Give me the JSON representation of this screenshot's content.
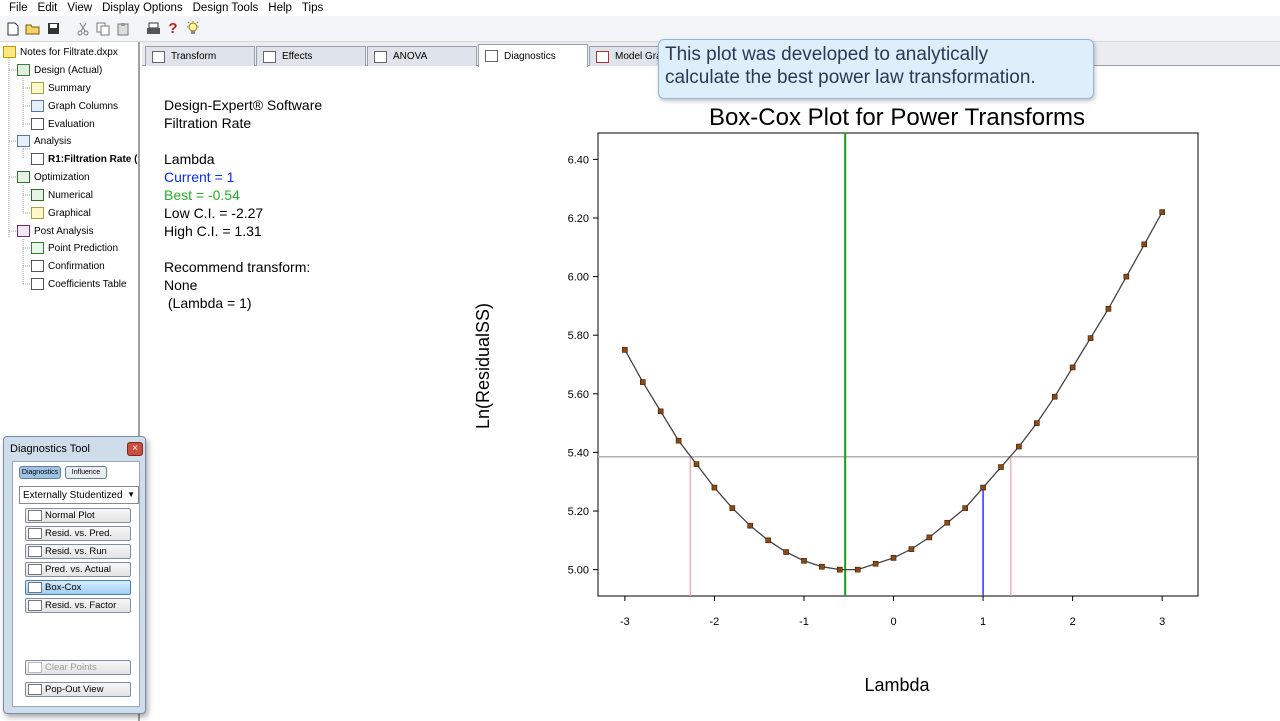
{
  "menu": [
    "File",
    "Edit",
    "View",
    "Display Options",
    "Design Tools",
    "Help",
    "Tips"
  ],
  "toolbar": {
    "icons": [
      "new-file-icon",
      "open-folder-icon",
      "save-icon",
      "cut-icon",
      "copy-icon",
      "paste-icon",
      "print-icon",
      "help-icon",
      "tip-lightbulb-icon"
    ]
  },
  "tree": {
    "root": "Notes for Filtrate.dxpx",
    "design": "Design (Actual)",
    "summary": "Summary",
    "graph_columns": "Graph Columns",
    "evaluation": "Evaluation",
    "analysis": "Analysis",
    "r1": "R1:Filtration Rate (",
    "optimization": "Optimization",
    "numerical": "Numerical",
    "graphical": "Graphical",
    "post_analysis": "Post Analysis",
    "point_prediction": "Point Prediction",
    "confirmation": "Confirmation",
    "coefficients_table": "Coefficients Table"
  },
  "tabs": {
    "transform": "Transform",
    "effects": "Effects",
    "anova": "ANOVA",
    "diagnostics": "Diagnostics",
    "model_graphs": "Model Gra"
  },
  "callout": {
    "line1": "This plot was developed to analytically",
    "line2": "calculate the best power law transformation."
  },
  "info": {
    "software": "Design-Expert® Software",
    "response": "Filtration Rate",
    "lambda_heading": "Lambda",
    "current": "Current = 1",
    "best": "Best = -0.54",
    "low_ci": "Low C.I. = -2.27",
    "high_ci": "High C.I. = 1.31",
    "recommend": "Recommend transform:",
    "recommend_value": "None",
    "recommend_lambda": " (Lambda = 1)"
  },
  "chart_data": {
    "type": "line",
    "title": "Box-Cox Plot for Power Transforms",
    "xlabel": "Lambda",
    "ylabel": "Ln(ResidualSS)",
    "xlim": [
      -3.3,
      3.4
    ],
    "ylim": [
      4.91,
      6.49
    ],
    "xticks": [
      -3,
      -2,
      -1,
      0,
      1,
      2,
      3
    ],
    "xtick_labels": [
      "-3",
      "-2",
      "-1",
      "0",
      "1",
      "2",
      "3"
    ],
    "yticks": [
      5.0,
      5.2,
      5.4,
      5.6,
      5.8,
      6.0,
      6.2,
      6.4
    ],
    "ytick_labels": [
      "5.00",
      "5.20",
      "5.40",
      "5.60",
      "5.80",
      "6.00",
      "6.20",
      "6.40"
    ],
    "x": [
      -3.0,
      -2.8,
      -2.6,
      -2.4,
      -2.2,
      -2.0,
      -1.8,
      -1.6,
      -1.4,
      -1.2,
      -1.0,
      -0.8,
      -0.6,
      -0.4,
      -0.2,
      0.0,
      0.2,
      0.4,
      0.6,
      0.8,
      1.0,
      1.2,
      1.4,
      1.6,
      1.8,
      2.0,
      2.2,
      2.4,
      2.6,
      2.8,
      3.0
    ],
    "y": [
      5.75,
      5.64,
      5.54,
      5.44,
      5.36,
      5.28,
      5.21,
      5.15,
      5.1,
      5.06,
      5.03,
      5.01,
      5.0,
      5.0,
      5.02,
      5.04,
      5.07,
      5.11,
      5.16,
      5.21,
      5.28,
      5.35,
      5.42,
      5.5,
      5.59,
      5.69,
      5.79,
      5.89,
      6.0,
      6.11,
      6.22
    ],
    "best_lambda": -0.54,
    "current_lambda": 1,
    "ci": [
      -2.27,
      1.31
    ],
    "ci_threshold": 5.385,
    "grid": false,
    "colors": {
      "best": "#1a9b1a",
      "current": "#3333ff",
      "ci": "#f0a0a8",
      "threshold": "#b0b0b0",
      "curve": "#444444",
      "points": "#8a4a14"
    }
  },
  "diagnostics_tool": {
    "title": "Diagnostics Tool",
    "close": "×",
    "tab_diagnostics": "Diagnostics",
    "tab_influence": "Influence",
    "residual_type": "Externally Studentized",
    "buttons": {
      "normal_plot": "Normal Plot",
      "resid_vs_pred": "Resid. vs. Pred.",
      "resid_vs_run": "Resid. vs. Run",
      "pred_vs_actual": "Pred. vs. Actual",
      "box_cox": "Box-Cox",
      "resid_vs_factor": "Resid. vs. Factor",
      "clear_points": "Clear Points",
      "pop_out_view": "Pop-Out View"
    }
  }
}
